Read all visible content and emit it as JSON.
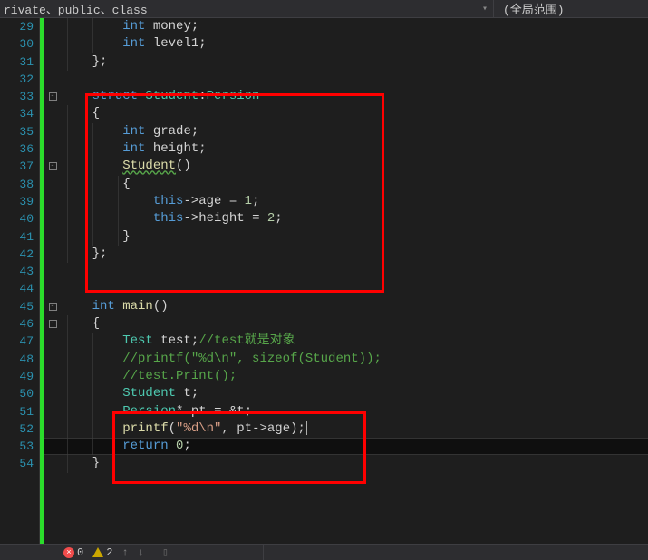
{
  "toolbar": {
    "scope_left": "rivate、public、class",
    "scope_right": "(全局范围)"
  },
  "gutter": {
    "start": 29,
    "end": 54
  },
  "code": {
    "l29": {
      "kw": "int",
      "id": " money",
      "pl": ";"
    },
    "l30": {
      "kw": "int",
      "id": " level1",
      "pl": ";"
    },
    "l31": {
      "pl": "};"
    },
    "l33a": {
      "kw": "struct ",
      "t1": "Student",
      "op": ":",
      "t2": "Persion"
    },
    "l34": {
      "pl": "{"
    },
    "l35": {
      "kw": "int",
      "id": " grade",
      "pl": ";"
    },
    "l36": {
      "kw": "int",
      "id": " height",
      "pl": ";"
    },
    "l37": {
      "fn": "Student",
      "pl": "()"
    },
    "l38": {
      "pl": "{"
    },
    "l39": {
      "kw": "this",
      "op": "->",
      "id": "age ",
      "eq": "= ",
      "num": "1",
      "pl": ";"
    },
    "l40": {
      "kw": "this",
      "op": "->",
      "id": "height ",
      "eq": "= ",
      "num": "2",
      "pl": ";"
    },
    "l41": {
      "pl": "}"
    },
    "l42": {
      "pl": "};"
    },
    "l45": {
      "kw": "int ",
      "fn": "main",
      "pl": "()"
    },
    "l46": {
      "pl": "{"
    },
    "l47": {
      "t": "Test ",
      "id": "test",
      "pl": ";",
      "cm": "//test就是对象"
    },
    "l48": {
      "cm": "//printf(\"%d\\n\", sizeof(Student));"
    },
    "l49": {
      "cm": "//test.Print();"
    },
    "l50": {
      "t": "Student ",
      "id": "t",
      "pl": ";"
    },
    "l51": {
      "t": "Persion",
      "op": "* ",
      "id": "pt ",
      "eq": "= &",
      "id2": "t",
      "pl": ";"
    },
    "l52": {
      "fn": "printf",
      "op1": "(",
      "str": "\"%d\\n\"",
      "op2": ", ",
      "id": "pt",
      "ar": "->",
      "id2": "age",
      "op3": ");"
    },
    "l53": {
      "kw": "return ",
      "num": "0",
      "pl": ";"
    },
    "l54": {
      "pl": "}"
    }
  },
  "status": {
    "errors": "0",
    "warnings": "2"
  }
}
